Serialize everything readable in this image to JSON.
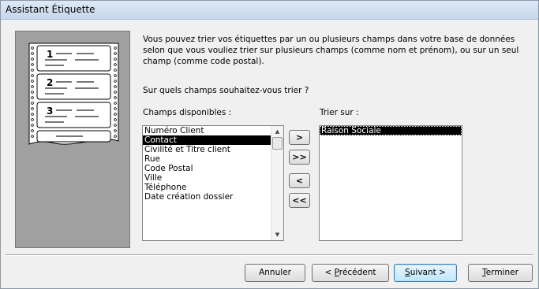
{
  "window": {
    "title": "Assistant Étiquette"
  },
  "preview": {
    "label_numbers": [
      "1",
      "2",
      "3"
    ]
  },
  "instructions": "Vous pouvez trier vos étiquettes par un ou plusieurs champs dans votre base de données selon que vous vouliez trier sur plusieurs champs (comme nom et prénom), ou sur un seul champ (comme code postal).",
  "question": "Sur quels champs souhaitez-vous trier ?",
  "available": {
    "label": "Champs disponibles :",
    "items": [
      "Numéro Client",
      "Contact",
      "Civilité et Titre client",
      "Rue",
      "Code Postal",
      "Ville",
      "Téléphone",
      "Date création dossier"
    ],
    "selected_index": 1
  },
  "sort": {
    "label": "Trier sur :",
    "items": [
      "Raison Sociale"
    ]
  },
  "move_buttons": {
    "add_one": ">",
    "add_all": ">>",
    "remove_one": "<",
    "remove_all": "<<"
  },
  "footer": {
    "cancel": "Annuler",
    "previous_prefix": "< ",
    "previous_mnemonic": "P",
    "previous_rest": "récédent",
    "next_mnemonic": "S",
    "next_rest": "uivant >",
    "finish_mnemonic": "T",
    "finish_rest": "erminer"
  }
}
